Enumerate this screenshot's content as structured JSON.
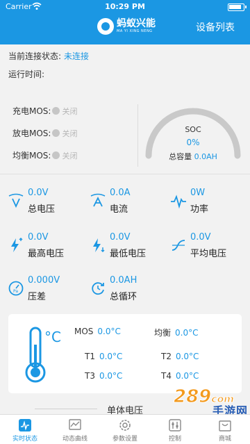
{
  "status_bar": {
    "carrier": "Carrier",
    "time": "10:29 PM"
  },
  "header": {
    "logo_cn": "蚂蚁兴能",
    "logo_en": "MA YI XING NENG",
    "device_list": "设备列表"
  },
  "connection": {
    "label": "当前连接状态:",
    "value": "未连接"
  },
  "run_time": {
    "label": "运行时间:"
  },
  "mos": [
    {
      "label": "充电MOS:",
      "state": "关闭"
    },
    {
      "label": "放电MOS:",
      "state": "关闭"
    },
    {
      "label": "均衡MOS:",
      "state": "关闭"
    }
  ],
  "soc": {
    "label": "SOC",
    "value": "0%",
    "capacity_label": "总容量",
    "capacity_value": "0.0AH",
    "level": 0
  },
  "metrics": [
    {
      "value": "0.0V",
      "label": "总电压",
      "icon": "voltage-icon"
    },
    {
      "value": "0.0A",
      "label": "电流",
      "icon": "current-icon"
    },
    {
      "value": "0W",
      "label": "功率",
      "icon": "power-icon"
    },
    {
      "value": "0.0V",
      "label": "最高电压",
      "icon": "max-voltage-icon"
    },
    {
      "value": "0.0V",
      "label": "最低电压",
      "icon": "min-voltage-icon"
    },
    {
      "value": "0.0V",
      "label": "平均电压",
      "icon": "avg-voltage-icon"
    },
    {
      "value": "0.000V",
      "label": "压差",
      "icon": "pressure-gauge-icon"
    },
    {
      "value": "0.0AH",
      "label": "总循环",
      "icon": "cycle-icon"
    }
  ],
  "temperature": {
    "unit_symbol": "°C",
    "mos_label": "MOS",
    "mos_value": "0.0°C",
    "balance_label": "均衡",
    "balance_value": "0.0°C",
    "t1_label": "T1",
    "t1_value": "0.0°C",
    "t2_label": "T2",
    "t2_value": "0.0°C",
    "t3_label": "T3",
    "t3_value": "0.0°C",
    "t4_label": "T4",
    "t4_value": "0.0°C"
  },
  "cell_section": {
    "label": "单体电压"
  },
  "watermark": {
    "number": "289",
    "suffix": "com",
    "text": "手游网"
  },
  "bottom_nav": [
    {
      "label": "实时状态",
      "icon": "realtime-icon",
      "active": true
    },
    {
      "label": "动态曲线",
      "icon": "curve-icon",
      "active": false
    },
    {
      "label": "参数设置",
      "icon": "settings-icon",
      "active": false
    },
    {
      "label": "控制",
      "icon": "control-icon",
      "active": false
    },
    {
      "label": "商城",
      "icon": "mall-icon",
      "active": false
    }
  ],
  "colors": {
    "primary": "#1b97e3",
    "background": "#f2f2f2",
    "muted": "#b5b5b5"
  }
}
